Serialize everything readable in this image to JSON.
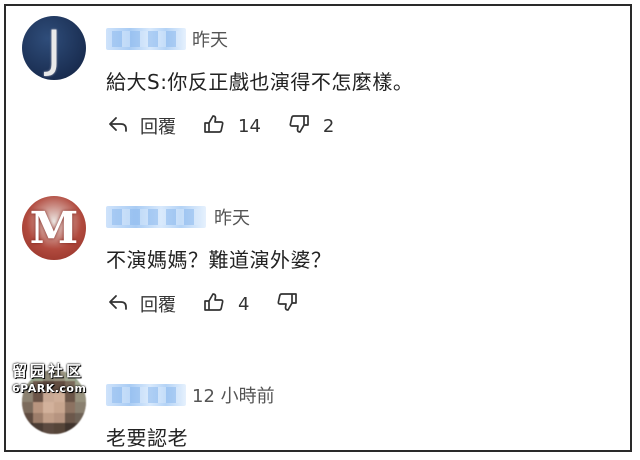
{
  "comments": [
    {
      "avatar_letter": "J",
      "time": "昨天",
      "text": "給大S:你反正戲也演得不怎麼樣。",
      "reply_label": "回覆",
      "likes": "14",
      "dislikes": "2"
    },
    {
      "avatar_letter": "M",
      "time": "昨天",
      "text": "不演媽媽？難道演外婆？",
      "reply_label": "回覆",
      "likes": "4",
      "dislikes": ""
    },
    {
      "time": "12 小時前",
      "text": "老要認老"
    }
  ],
  "watermark": {
    "cn": "留园社区",
    "en": "6PARK.com"
  },
  "icons": {
    "reply": "reply-arrow-icon",
    "like": "thumbs-up-icon",
    "dislike": "thumbs-down-icon"
  }
}
